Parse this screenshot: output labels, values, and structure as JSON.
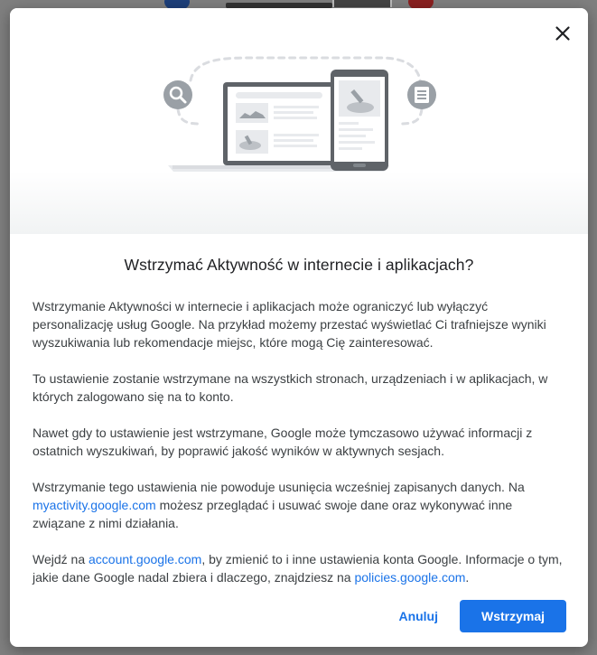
{
  "dialog": {
    "title": "Wstrzymać Aktywność w internecie i aplikacjach?",
    "paragraphs": {
      "p1": "Wstrzymanie Aktywności w internecie i aplikacjach może ograniczyć lub wyłączyć personalizację usług Google. Na przykład możemy przestać wyświetlać Ci trafniejsze wyniki wyszukiwania lub rekomendacje miejsc, które mogą Cię zainteresować.",
      "p2": "To ustawienie zostanie wstrzymane na wszystkich stronach, urządzeniach i w aplikacjach, w których zalogowano się na to konto.",
      "p3": "Nawet gdy to ustawienie jest wstrzymane, Google może tymczasowo używać informacji z ostatnich wyszukiwań, by poprawić jakość wyników w aktywnych sesjach.",
      "p4_before": "Wstrzymanie tego ustawienia nie powoduje usunięcia wcześniej zapisanych danych. Na ",
      "p4_link": "myactivity.google.com",
      "p4_after": " możesz przeglądać i usuwać swoje dane oraz wykonywać inne związane z nimi działania.",
      "p5_before": "Wejdź na ",
      "p5_link1": "account.google.com",
      "p5_middle": ", by zmienić to i inne ustawienia konta Google. Informacje o tym, jakie dane Google nadal zbiera i dlaczego, znajdziesz na ",
      "p5_link2": "policies.google.com",
      "p5_after": "."
    },
    "buttons": {
      "cancel": "Anuluj",
      "confirm": "Wstrzymaj"
    },
    "icons": {
      "close": "close-icon",
      "search": "search-icon",
      "document": "document-icon",
      "laptop": "laptop-illustration",
      "phone": "phone-illustration"
    }
  },
  "colors": {
    "accent": "#1a73e8",
    "title_text": "#202124",
    "body_text": "#3c4043",
    "illustration_gray": "#9aa0a6"
  }
}
